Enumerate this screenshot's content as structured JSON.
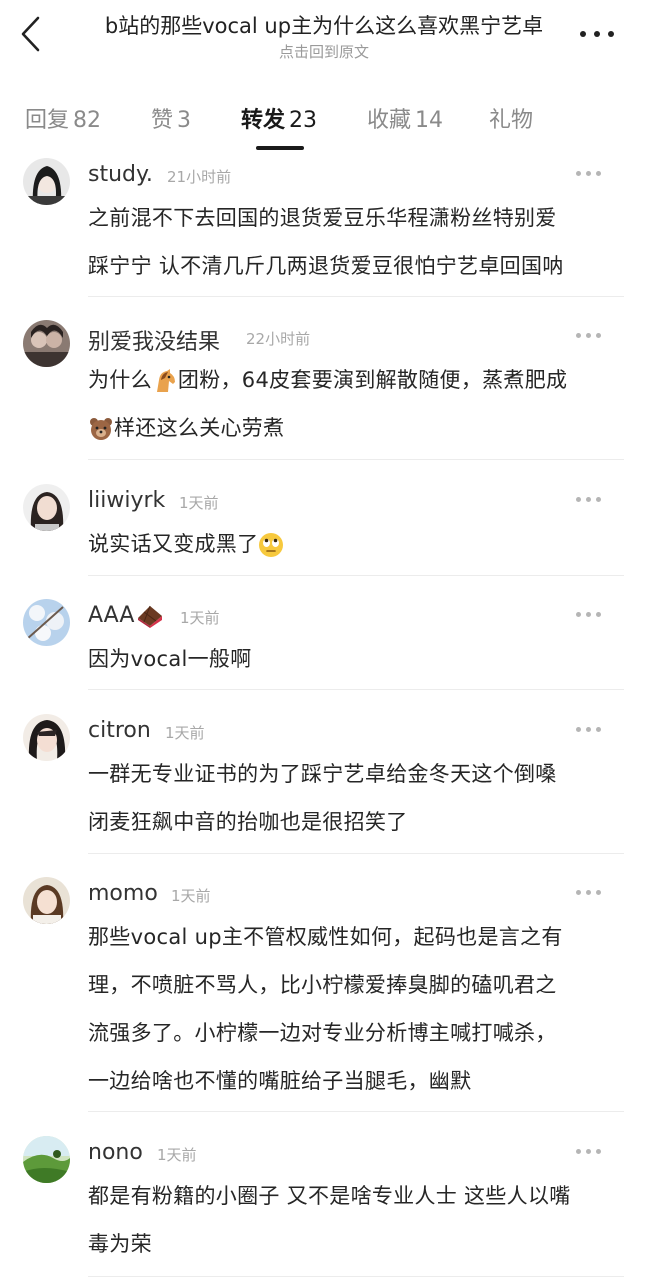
{
  "header": {
    "title": "b站的那些vocal up主为什么这么喜欢黑宁艺卓",
    "subtitle": "点击回到原文"
  },
  "tabs": [
    {
      "label": "回复",
      "count": "82"
    },
    {
      "label": "赞",
      "count": "3"
    },
    {
      "label": "转发",
      "count": "23"
    },
    {
      "label": "收藏",
      "count": "14"
    },
    {
      "label": "礼物",
      "count": ""
    }
  ],
  "comments": [
    {
      "user": "study.",
      "time": "21小时前",
      "lines": [
        "之前混不下去回国的退货爱豆乐华程潇粉丝特别爱",
        "踩宁宁 认不清几斤几两退货爱豆很怕宁艺卓回国呐"
      ]
    },
    {
      "user": "别爱我没结果",
      "time": "22小时前",
      "lines": [
        "为什么",
        "团粉，64皮套要演到解散随便，蒸煮肥成",
        "样还这么关心劳煮"
      ]
    },
    {
      "user": "liiwiyrk",
      "time": "1天前",
      "lines": [
        "说实话又变成黑了"
      ]
    },
    {
      "user": "AAA",
      "time": "1天前",
      "lines": [
        "因为vocal一般啊"
      ]
    },
    {
      "user": "citron",
      "time": "1天前",
      "lines": [
        "一群无专业证书的为了踩宁艺卓给金冬天这个倒嗓",
        "闭麦狂飙中音的抬咖也是很招笑了"
      ]
    },
    {
      "user": "momo",
      "time": "1天前",
      "lines": [
        "那些vocal up主不管权威性如何，起码也是言之有",
        "理，不喷脏不骂人，比小柠檬爱捧臭脚的磕叽君之",
        "流强多了。小柠檬一边对专业分析博主喊打喊杀，",
        "一边给啥也不懂的嘴脏给子当腿毛，幽默"
      ]
    },
    {
      "user": "nono",
      "time": "1天前",
      "lines": [
        "都是有粉籍的小圈子 又不是啥专业人士 这些人以嘴",
        "毒为荣"
      ]
    }
  ],
  "icons": {
    "back": "chevron-left-icon",
    "more": "more-horizontal-icon",
    "comment_more": "more-horizontal-icon",
    "horse": "horse-emoji-icon",
    "bear": "bear-emoji-icon",
    "eye_roll": "eye-roll-emoji-icon",
    "chocolate": "chocolate-emoji-icon"
  }
}
